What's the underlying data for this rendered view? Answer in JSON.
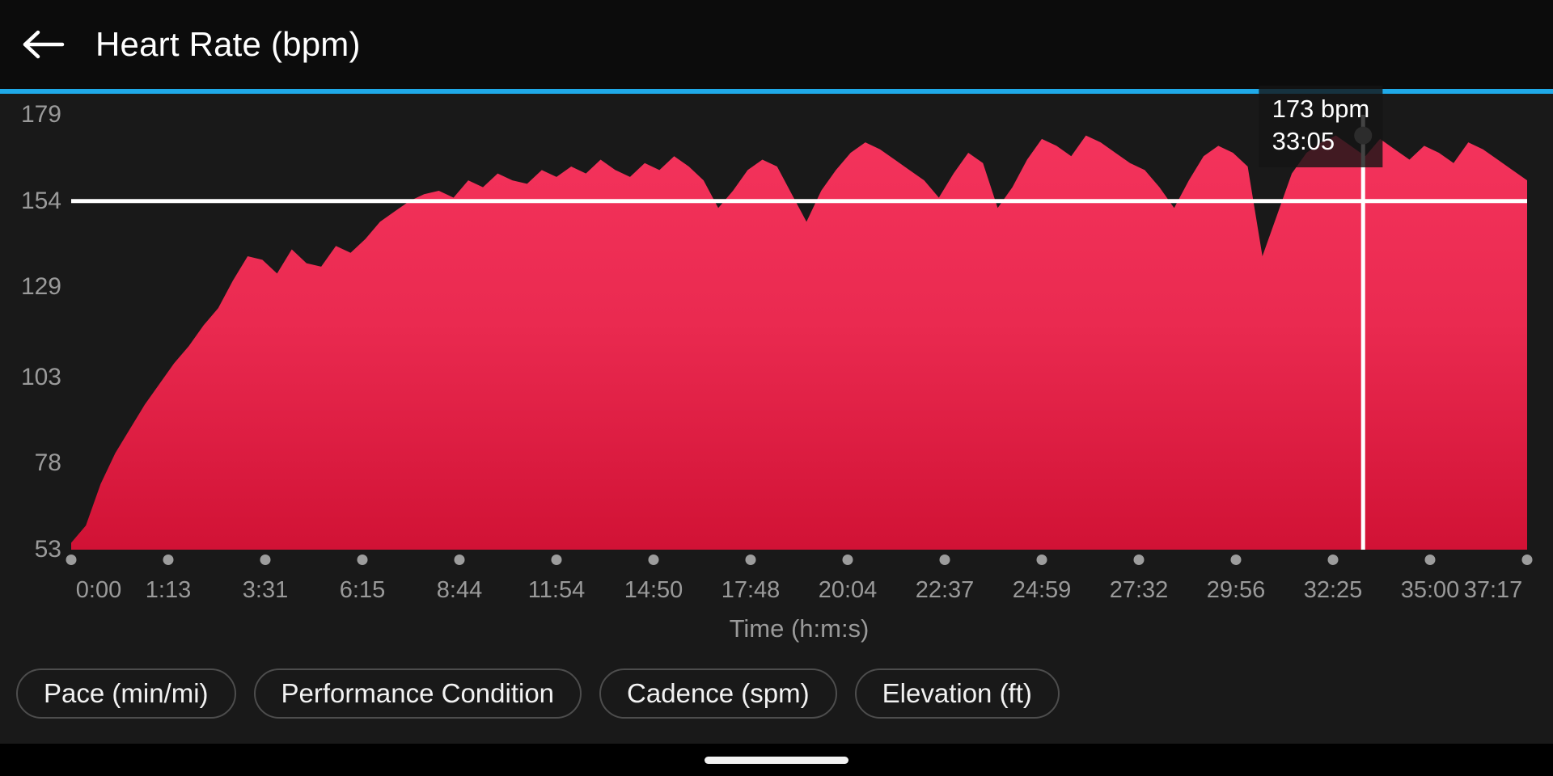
{
  "header": {
    "back_icon": "arrow-left-icon",
    "title": "Heart Rate (bpm)",
    "accent_color": "#1fa9e8"
  },
  "metric_buttons": [
    {
      "label": "Pace (min/mi)"
    },
    {
      "label": "Performance Condition"
    },
    {
      "label": "Cadence (spm)"
    },
    {
      "label": "Elevation (ft)"
    }
  ],
  "tooltip": {
    "value_line": "173 bpm",
    "time_line": "33:05"
  },
  "chart_data": {
    "type": "area",
    "title": "Heart Rate (bpm)",
    "xlabel": "Time (h:m:s)",
    "ylabel": "",
    "ylim": [
      53,
      179
    ],
    "yticks": [
      179,
      154,
      129,
      103,
      78,
      53
    ],
    "xticks": [
      "0:00",
      "1:13",
      "3:31",
      "6:15",
      "8:44",
      "11:54",
      "14:50",
      "17:48",
      "20:04",
      "22:37",
      "24:59",
      "27:32",
      "29:56",
      "32:25",
      "35:00",
      "37:17"
    ],
    "grid": false,
    "legend": null,
    "area_gradient_top": "#f4335c",
    "area_gradient_bottom": "#d11235",
    "average_line": {
      "value": 154,
      "color": "#ffffff"
    },
    "cursor": {
      "time": "33:05",
      "value": 173,
      "color": "#ffffff",
      "marker_color": "#8c8c8c"
    },
    "x": [
      0.0,
      0.6,
      1.2,
      1.8,
      2.4,
      3.0,
      3.6,
      4.2,
      4.8,
      5.4,
      6.0,
      6.6,
      7.2,
      7.8,
      8.4,
      9.0,
      9.6,
      10.2,
      10.8,
      11.4,
      12.0,
      12.6,
      13.2,
      13.8,
      14.4,
      15.0,
      15.6,
      16.2,
      16.8,
      17.4,
      18.0,
      18.6,
      19.2,
      19.8,
      20.4,
      21.0,
      21.6,
      22.2,
      22.8,
      23.4,
      24.0,
      24.6,
      25.2,
      25.8,
      26.4,
      27.0,
      27.6,
      28.2,
      28.8,
      29.4,
      30.0,
      30.6,
      31.2,
      31.8,
      32.4,
      33.0,
      33.6,
      34.2,
      34.8,
      35.4,
      36.0,
      36.6,
      37.2
    ],
    "values": [
      55,
      60,
      72,
      81,
      88,
      95,
      101,
      107,
      112,
      118,
      123,
      131,
      138,
      137,
      133,
      140,
      136,
      135,
      141,
      139,
      143,
      148,
      151,
      154,
      156,
      157,
      155,
      160,
      158,
      162,
      160,
      159,
      163,
      161,
      164,
      162,
      166,
      163,
      161,
      165,
      163,
      167,
      164,
      160,
      152,
      157,
      163,
      166,
      164,
      156,
      148,
      157,
      163,
      168,
      171,
      169,
      166,
      163,
      160,
      155,
      162,
      168,
      165,
      152,
      158,
      166,
      172,
      170,
      167,
      173,
      171,
      168,
      165,
      163,
      158,
      152,
      160,
      167,
      170,
      168,
      164,
      138,
      150,
      162,
      168,
      171,
      173,
      170,
      167,
      172,
      169,
      166,
      170,
      168,
      165,
      171,
      169,
      166,
      163,
      160
    ],
    "series_name": "Heart Rate",
    "units": "bpm"
  }
}
